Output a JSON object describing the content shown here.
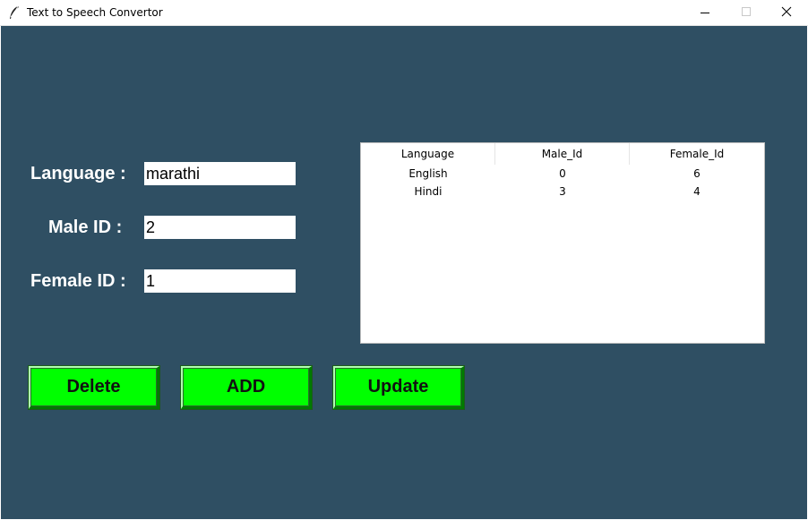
{
  "window": {
    "title": "Text to Speech Convertor",
    "icon": "feather-icon"
  },
  "form": {
    "language_label": "Language :",
    "language_value": "marathi",
    "male_label": "Male ID :",
    "male_value": "2",
    "female_label": "Female ID :",
    "female_value": "1"
  },
  "table": {
    "columns": [
      "Language",
      "Male_Id",
      "Female_Id"
    ],
    "rows": [
      [
        "English",
        "0",
        "6"
      ],
      [
        "Hindi",
        "3",
        "4"
      ]
    ]
  },
  "buttons": {
    "delete": "Delete",
    "add": "ADD",
    "update": "Update"
  },
  "colors": {
    "background": "#2f4f63",
    "button": "#00ff00"
  }
}
